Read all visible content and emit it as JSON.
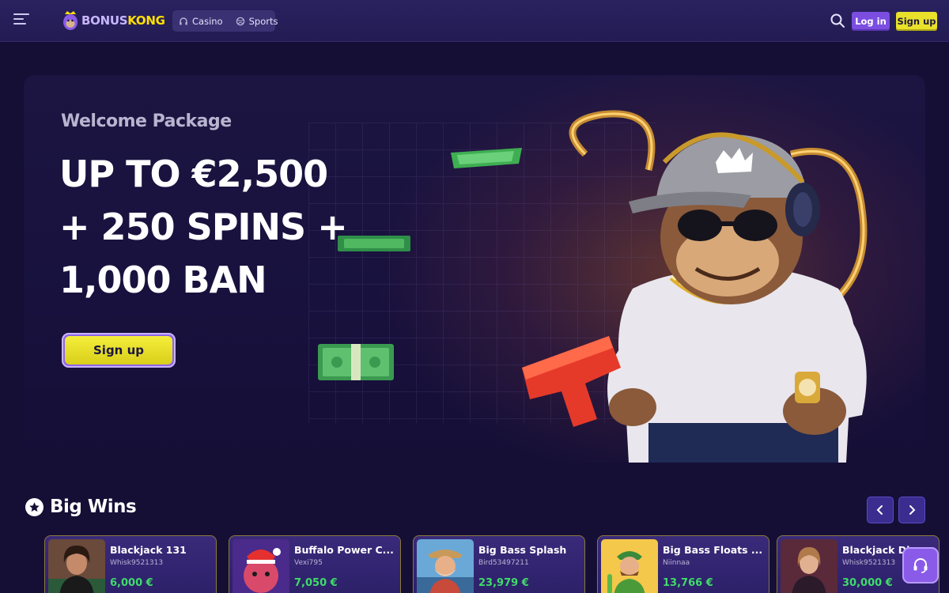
{
  "header": {
    "logo_part1": "BONUS",
    "logo_part2": "KONG",
    "nav": [
      {
        "label": "Casino",
        "icon": "headphones-icon"
      },
      {
        "label": "Sports",
        "icon": "ball-icon"
      }
    ],
    "login_label": "Log in",
    "signup_label": "Sign up"
  },
  "hero": {
    "eyebrow": "Welcome Package",
    "line1": "UP TO €2,500",
    "line2": "+ 250 SPINS +",
    "line3": "1,000 BAN",
    "cta_label": "Sign up"
  },
  "big_wins": {
    "title": "Big Wins",
    "cards": [
      {
        "game": "Blackjack 131",
        "user": "Whisk9521313",
        "amount": "6,000 €"
      },
      {
        "game": "Buffalo Power C...",
        "user": "Vexi795",
        "amount": "7,050 €"
      },
      {
        "game": "Big Bass Splash",
        "user": "Bird53497211",
        "amount": "23,979 €"
      },
      {
        "game": "Big Bass Floats ...",
        "user": "Niinnaa",
        "amount": "13,766 €"
      },
      {
        "game": "Blackjack Diam...",
        "user": "Whisk9521313",
        "amount": "30,000 €"
      }
    ]
  },
  "colors": {
    "background": "#150f36",
    "primary_purple": "#7b4de0",
    "accent_yellow": "#e9e12a",
    "win_green": "#3fdc6a"
  }
}
